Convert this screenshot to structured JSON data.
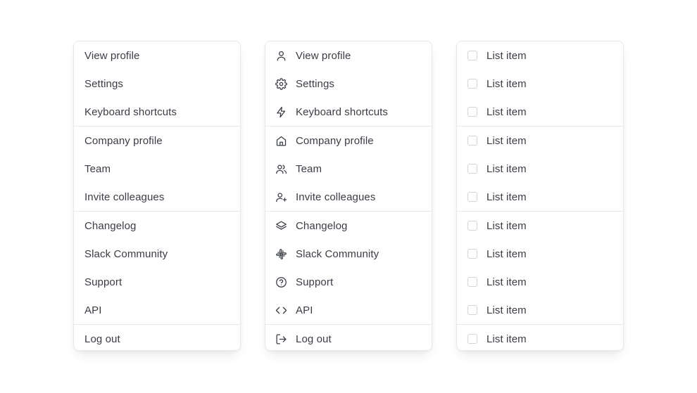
{
  "menu_plain": {
    "groups": [
      {
        "items": [
          {
            "label": "View profile"
          },
          {
            "label": "Settings"
          },
          {
            "label": "Keyboard shortcuts"
          }
        ]
      },
      {
        "items": [
          {
            "label": "Company profile"
          },
          {
            "label": "Team"
          },
          {
            "label": "Invite colleagues"
          }
        ]
      },
      {
        "items": [
          {
            "label": "Changelog"
          },
          {
            "label": "Slack Community"
          },
          {
            "label": "Support"
          },
          {
            "label": "API"
          }
        ]
      },
      {
        "items": [
          {
            "label": "Log out"
          }
        ]
      }
    ]
  },
  "menu_icons": {
    "groups": [
      {
        "items": [
          {
            "label": "View profile",
            "icon": "user-icon"
          },
          {
            "label": "Settings",
            "icon": "gear-icon"
          },
          {
            "label": "Keyboard shortcuts",
            "icon": "lightning-icon"
          }
        ]
      },
      {
        "items": [
          {
            "label": "Company profile",
            "icon": "home-icon"
          },
          {
            "label": "Team",
            "icon": "users-icon"
          },
          {
            "label": "Invite colleagues",
            "icon": "user-plus-icon"
          }
        ]
      },
      {
        "items": [
          {
            "label": "Changelog",
            "icon": "layers-icon"
          },
          {
            "label": "Slack Community",
            "icon": "slack-icon"
          },
          {
            "label": "Support",
            "icon": "help-circle-icon"
          },
          {
            "label": "API",
            "icon": "code-icon"
          }
        ]
      },
      {
        "items": [
          {
            "label": "Log out",
            "icon": "logout-icon"
          }
        ]
      }
    ]
  },
  "menu_checkbox": {
    "groups": [
      {
        "items": [
          {
            "label": "List item",
            "checked": false
          },
          {
            "label": "List item",
            "checked": false
          },
          {
            "label": "List item",
            "checked": false
          }
        ]
      },
      {
        "items": [
          {
            "label": "List item",
            "checked": false
          },
          {
            "label": "List item",
            "checked": false
          },
          {
            "label": "List item",
            "checked": false
          }
        ]
      },
      {
        "items": [
          {
            "label": "List item",
            "checked": false
          },
          {
            "label": "List item",
            "checked": false
          },
          {
            "label": "List item",
            "checked": false
          },
          {
            "label": "List item",
            "checked": false
          }
        ]
      },
      {
        "items": [
          {
            "label": "List item",
            "checked": false
          }
        ]
      }
    ]
  },
  "colors": {
    "text": "#3a3d45",
    "border": "#e7e8ec",
    "checkbox_border": "#d1d4da",
    "icon": "#3a3d45"
  }
}
